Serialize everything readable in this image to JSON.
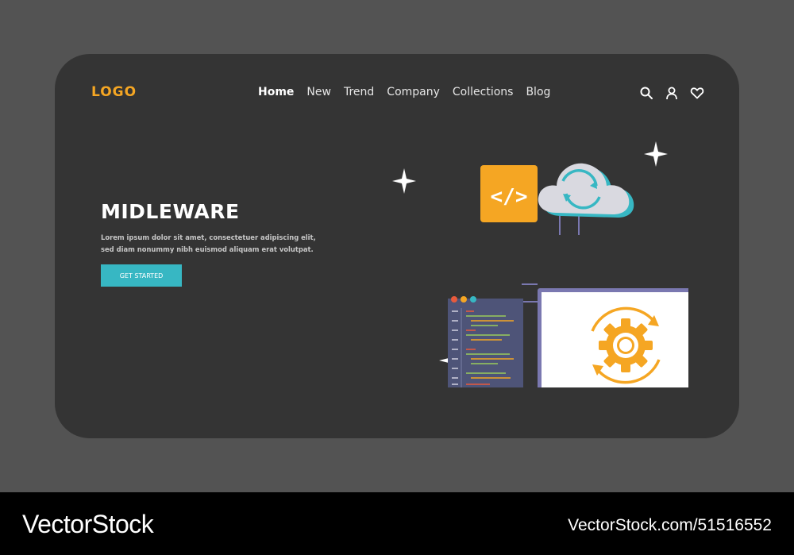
{
  "header": {
    "logo": "LOGO",
    "nav": [
      {
        "label": "Home",
        "active": true
      },
      {
        "label": "New"
      },
      {
        "label": "Trend"
      },
      {
        "label": "Company"
      },
      {
        "label": "Collections"
      },
      {
        "label": "Blog"
      }
    ],
    "icons": [
      "search-icon",
      "user-icon",
      "heart-icon"
    ]
  },
  "hero": {
    "title": "MIDLEWARE",
    "description": "Lorem ipsum dolor sit amet, consectetuer adipiscing elit, sed diam nonummy nibh euismod aliquam erat volutpat.",
    "cta_label": "GET STARTED"
  },
  "illustration": {
    "code_tag_label": "</>"
  },
  "watermark": {
    "brand": "VectorStock",
    "brand_mark": "®",
    "url": "VectorStock.com/51516552"
  },
  "colors": {
    "page_bg": "#535353",
    "card_bg": "#343434",
    "accent_orange": "#f5a623",
    "accent_teal": "#37b7c3",
    "monitor_frame": "#7a78b0"
  }
}
